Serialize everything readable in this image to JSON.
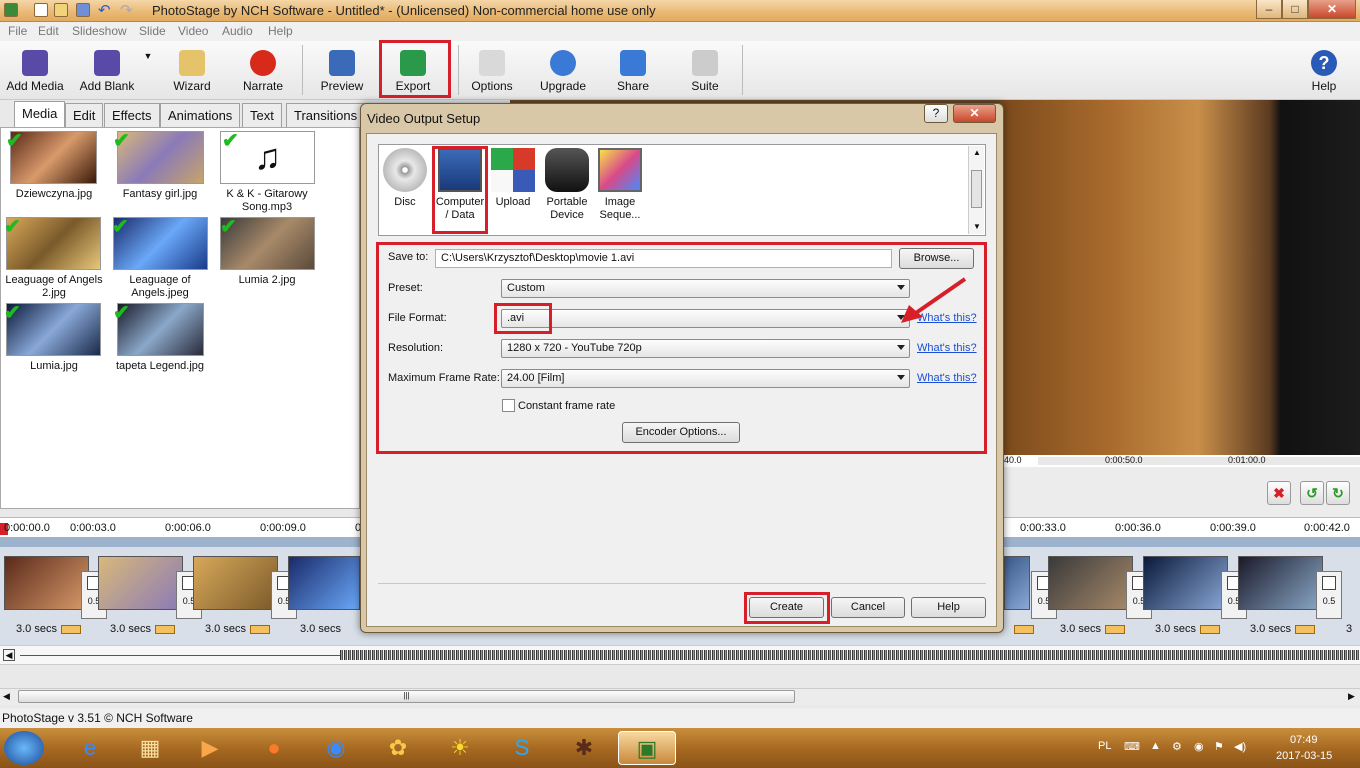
{
  "window": {
    "title": "PhotoStage by NCH Software - Untitled* - (Unlicensed) Non-commercial home use only",
    "min": "–",
    "max": "□",
    "close": "✕"
  },
  "menubar": [
    "File",
    "Edit",
    "Slideshow",
    "Slide",
    "Video",
    "Audio",
    "Help"
  ],
  "toolbar": {
    "add_media": "Add Media",
    "add_blank": "Add Blank",
    "wizard": "Wizard",
    "narrate": "Narrate",
    "preview": "Preview",
    "export": "Export",
    "options": "Options",
    "upgrade": "Upgrade",
    "share": "Share",
    "suite": "Suite",
    "help": "Help"
  },
  "tabs": [
    "Media",
    "Edit",
    "Effects",
    "Animations",
    "Text",
    "Transitions"
  ],
  "media": [
    {
      "name": "Dziewczyna.jpg",
      "checked": true,
      "color": "#a8624a"
    },
    {
      "name": "Fantasy girl.jpg",
      "checked": true,
      "color": "#c7a46a"
    },
    {
      "name": "K & K - Gitarowy Song.mp3",
      "checked": true,
      "color": "#ffffff"
    },
    {
      "name": "Leaguage of Angels 2.jpg",
      "checked": true,
      "color": "#b8884a"
    },
    {
      "name": "Leaguage of Angels.jpeg",
      "checked": true,
      "color": "#3a6ab8"
    },
    {
      "name": "Lumia 2.jpg",
      "checked": true,
      "color": "#6a5a4a"
    },
    {
      "name": "Lumia.jpg",
      "checked": true,
      "color": "#2a3a5a"
    },
    {
      "name": "tapeta Legend.jpg",
      "checked": true,
      "color": "#3a4a6a"
    }
  ],
  "preview": {
    "time_a": "40.0",
    "time_b": "0:00:50.0",
    "time_c": "0:01:00.0"
  },
  "timeline": {
    "ticks_left": [
      "0:00:00.0",
      "0:00:03.0",
      "0:00:06.0",
      "0:00:09.0",
      "0"
    ],
    "ticks_right": [
      "0:00:33.0",
      "0:00:36.0",
      "0:00:39.0",
      "0:00:42.0"
    ],
    "clip_duration": "3.0 secs",
    "transition_duration": "0.5",
    "tail": "3"
  },
  "status": "PhotoStage v 3.51 © NCH Software",
  "dialog": {
    "title": "Video Output Setup",
    "help_btn": "?",
    "close_btn": "✕",
    "outputs": [
      {
        "label": "Disc"
      },
      {
        "label": "Computer / Data"
      },
      {
        "label": "Upload"
      },
      {
        "label": "Portable Device"
      },
      {
        "label": "Image Seque..."
      }
    ],
    "save_to_label": "Save to:",
    "save_to_value": "C:\\Users\\Krzysztof\\Desktop\\movie 1.avi",
    "browse": "Browse...",
    "preset_label": "Preset:",
    "preset_value": "Custom",
    "format_label": "File Format:",
    "format_value": ".avi",
    "resolution_label": "Resolution:",
    "resolution_value": "1280 x 720 - YouTube 720p",
    "framerate_label": "Maximum Frame Rate:",
    "framerate_value": "24.00 [Film]",
    "whats_this": "What's this?",
    "constant_label": "Constant frame rate",
    "constant_checked": false,
    "encoder": "Encoder Options...",
    "create": "Create",
    "cancel": "Cancel",
    "help": "Help"
  },
  "taskbar": {
    "lang": "PL",
    "time": "07:49",
    "date": "2017-03-15"
  }
}
